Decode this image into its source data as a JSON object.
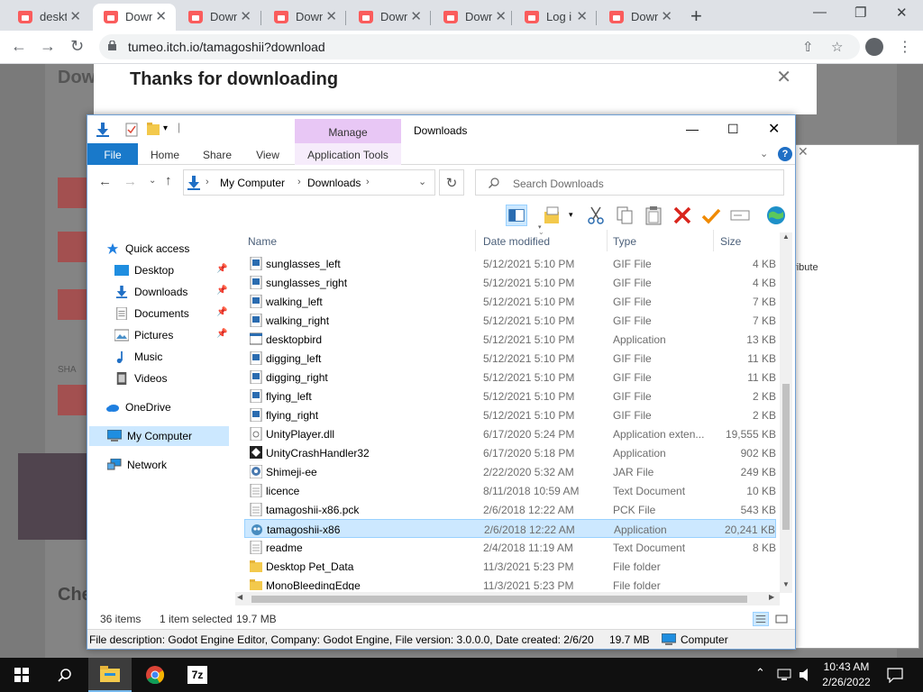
{
  "browser": {
    "tabs": [
      {
        "label": "deskt",
        "active": false
      },
      {
        "label": "Down",
        "active": true
      },
      {
        "label": "Down",
        "active": false
      },
      {
        "label": "Down",
        "active": false
      },
      {
        "label": "Down",
        "active": false
      },
      {
        "label": "Down",
        "active": false
      },
      {
        "label": "Log i",
        "active": false
      },
      {
        "label": "Down",
        "active": false
      }
    ],
    "url": "tumeo.itch.io/tamagoshii?download"
  },
  "webpage": {
    "heading_partial": "Dow",
    "modal_title": "Thanks for downloading",
    "side_text_1": "tribute",
    "bottom_partial": "Che",
    "share_partial": "SHA"
  },
  "explorer": {
    "title": "Downloads",
    "context_tab": "Manage",
    "ribbon_tabs": [
      "File",
      "Home",
      "Share",
      "View",
      "Application Tools"
    ],
    "breadcrumb": [
      "My Computer",
      "Downloads"
    ],
    "search_placeholder": "Search Downloads",
    "columns": [
      "Name",
      "Date modified",
      "Type",
      "Size"
    ],
    "nav": [
      {
        "label": "Quick access"
      },
      {
        "label": "Desktop"
      },
      {
        "label": "Downloads"
      },
      {
        "label": "Documents"
      },
      {
        "label": "Pictures"
      },
      {
        "label": "Music"
      },
      {
        "label": "Videos"
      },
      {
        "label": "OneDrive"
      },
      {
        "label": "My Computer"
      },
      {
        "label": "Network"
      }
    ],
    "files": [
      {
        "name": "sunglasses_left",
        "date": "5/12/2021 5:10 PM",
        "type": "GIF File",
        "size": "4 KB",
        "icon": "gif"
      },
      {
        "name": "sunglasses_right",
        "date": "5/12/2021 5:10 PM",
        "type": "GIF File",
        "size": "4 KB",
        "icon": "gif"
      },
      {
        "name": "walking_left",
        "date": "5/12/2021 5:10 PM",
        "type": "GIF File",
        "size": "7 KB",
        "icon": "gif"
      },
      {
        "name": "walking_right",
        "date": "5/12/2021 5:10 PM",
        "type": "GIF File",
        "size": "7 KB",
        "icon": "gif"
      },
      {
        "name": "desktopbird",
        "date": "5/12/2021 5:10 PM",
        "type": "Application",
        "size": "13 KB",
        "icon": "app"
      },
      {
        "name": "digging_left",
        "date": "5/12/2021 5:10 PM",
        "type": "GIF File",
        "size": "11 KB",
        "icon": "gif"
      },
      {
        "name": "digging_right",
        "date": "5/12/2021 5:10 PM",
        "type": "GIF File",
        "size": "11 KB",
        "icon": "gif"
      },
      {
        "name": "flying_left",
        "date": "5/12/2021 5:10 PM",
        "type": "GIF File",
        "size": "2 KB",
        "icon": "gif"
      },
      {
        "name": "flying_right",
        "date": "5/12/2021 5:10 PM",
        "type": "GIF File",
        "size": "2 KB",
        "icon": "gif"
      },
      {
        "name": "UnityPlayer.dll",
        "date": "6/17/2020 5:24 PM",
        "type": "Application exten...",
        "size": "19,555 KB",
        "icon": "dll"
      },
      {
        "name": "UnityCrashHandler32",
        "date": "6/17/2020 5:18 PM",
        "type": "Application",
        "size": "902 KB",
        "icon": "unity"
      },
      {
        "name": "Shimeji-ee",
        "date": "2/22/2020 5:32 AM",
        "type": "JAR File",
        "size": "249 KB",
        "icon": "jar"
      },
      {
        "name": "licence",
        "date": "8/11/2018 10:59 AM",
        "type": "Text Document",
        "size": "10 KB",
        "icon": "txt"
      },
      {
        "name": "tamagoshii-x86.pck",
        "date": "2/6/2018 12:22 AM",
        "type": "PCK File",
        "size": "543 KB",
        "icon": "txt"
      },
      {
        "name": "tamagoshii-x86",
        "date": "2/6/2018 12:22 AM",
        "type": "Application",
        "size": "20,241 KB",
        "icon": "godot",
        "selected": true
      },
      {
        "name": "readme",
        "date": "2/4/2018 11:19 AM",
        "type": "Text Document",
        "size": "8 KB",
        "icon": "txt"
      },
      {
        "name": "Desktop Pet_Data",
        "date": "11/3/2021 5:23 PM",
        "type": "File folder",
        "size": "",
        "icon": "folder"
      },
      {
        "name": "MonoBleedingEdge",
        "date": "11/3/2021 5:23 PM",
        "type": "File folder",
        "size": "",
        "icon": "folder"
      }
    ],
    "status": {
      "items": "36 items",
      "selected": "1 item selected",
      "size": "19.7 MB"
    },
    "info": {
      "description": "File description: Godot Engine Editor, Company: Godot Engine, File version: 3.0.0.0, Date created: 2/6/20",
      "size": "19.7 MB",
      "location": "Computer"
    }
  },
  "taskbar": {
    "time": "10:43 AM",
    "date": "2/26/2022"
  },
  "colors": {
    "accent": "#1979ca",
    "selection": "#cce8ff",
    "manage": "#e8c7f5"
  }
}
